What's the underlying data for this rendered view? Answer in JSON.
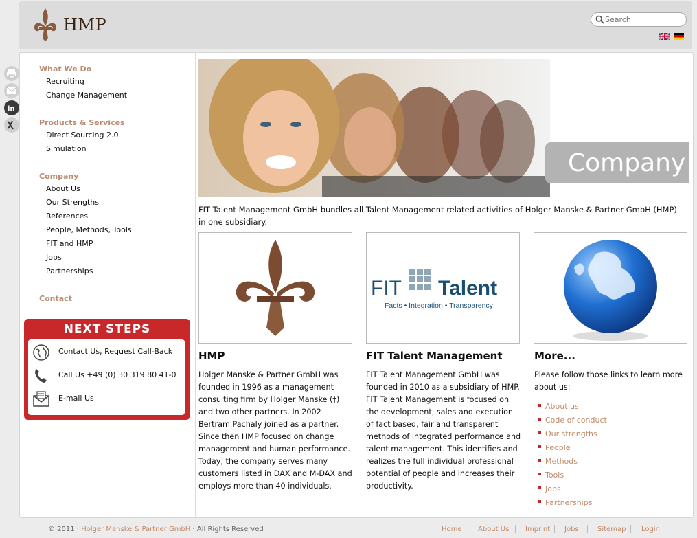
{
  "header": {
    "logo_text": "HMP",
    "search_placeholder": "Search",
    "languages": [
      "English",
      "Deutsch"
    ]
  },
  "share_icons": [
    "print-icon",
    "mail-icon",
    "linkedin-icon",
    "xing-icon"
  ],
  "sidebar": {
    "sections": [
      {
        "title": "What We Do",
        "items": [
          "Recruiting",
          "Change Management"
        ]
      },
      {
        "title": "Products & Services",
        "items": [
          "Direct Sourcing 2.0",
          "Simulation"
        ]
      },
      {
        "title": "Company",
        "items": [
          "About Us",
          "Our Strengths",
          "References",
          "People, Methods, Tools",
          "FIT and HMP",
          "Jobs",
          "Partnerships"
        ]
      },
      {
        "title": "Contact",
        "items": []
      }
    ],
    "next_steps": {
      "title": "NEXT STEPS",
      "items": [
        {
          "label": "Contact Us, Request Call-Back",
          "icon": "globe-icon"
        },
        {
          "label": "Call Us +49 (0) 30 319 80 41-0",
          "icon": "phone-icon"
        },
        {
          "label": "E-mail Us",
          "icon": "envelope-icon"
        }
      ]
    }
  },
  "hero": {
    "badge": "Company"
  },
  "intro": "FIT Talent Management GmbH bundles all Talent Management related activities of Holger Manske & Partner GmbH (HMP) in one subsidiary.",
  "columns": [
    {
      "title": "HMP",
      "text": "Holger Manske & Partner GmbH was founded in 1996 as a management consulting firm by Holger Manske (†) and two other partners. In 2002 Bertram Pachaly joined as a partner. Since then HMP focused on change management and human performance. Today, the company serves many customers listed in DAX and M-DAX and employs more than 40 individuals."
    },
    {
      "title": "FIT Talent Management",
      "text": "FIT Talent Management GmbH was founded in 2010 as a subsidiary of HMP. FIT Talent Management is focused on the development, sales and execution of fact based, fair and transparent methods of integrated performance and talent management. This identifies and realizes the full individual professional potential of people and increases their productivity.",
      "logo_fit": "FIT",
      "logo_talent": "Talent",
      "logo_tagline": "Facts • Integration • Transparency"
    },
    {
      "title": "More...",
      "text": "Please follow those links to learn more about us:",
      "links": [
        "About us",
        "Code of conduct",
        "Our strengths",
        "People",
        "Methods",
        "Tools",
        "Jobs",
        "Partnerships"
      ]
    }
  ],
  "footer": {
    "copyright_prefix": "© 2011 ·",
    "company": "Holger Manske & Partner GmbH",
    "copyright_suffix": "· All Rights Reserved",
    "links": [
      "Home",
      "About Us",
      "Imprint",
      "Jobs",
      "Sitemap",
      "Login"
    ]
  },
  "colors": {
    "accent": "#c28a69",
    "next_steps_red": "#c8282a",
    "header_bg": "#dcdcdc"
  }
}
